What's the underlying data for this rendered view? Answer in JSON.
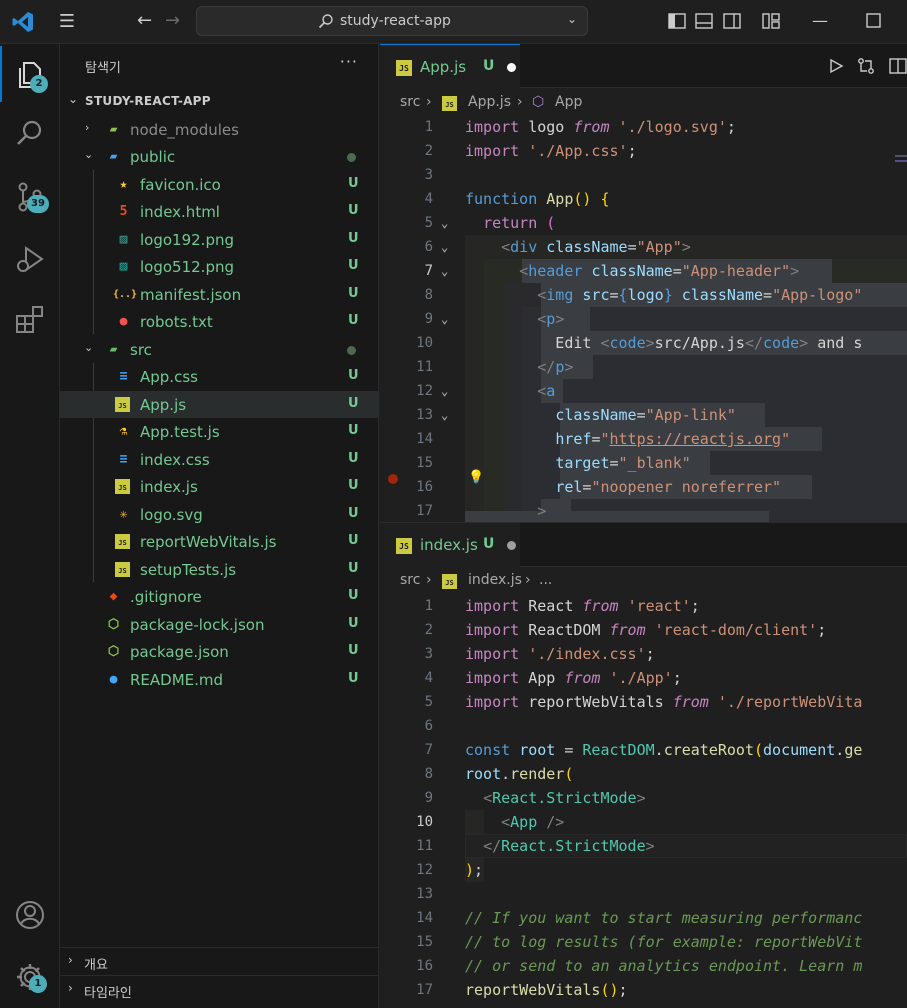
{
  "titlebar": {
    "search_text": "study-react-app",
    "icons": [
      "vscode-logo-icon",
      "menu-icon",
      "back-arrow-icon",
      "forward-arrow-icon",
      "search-icon",
      "chevron-down-icon",
      "toggle-primary-sidebar-icon",
      "toggle-panel-icon",
      "toggle-secondary-sidebar-icon",
      "customize-layout-icon",
      "minimize-icon",
      "maximize-icon"
    ]
  },
  "activitybar": {
    "explorer_badge": "2",
    "scm_badge": "39",
    "settings_badge": "1"
  },
  "sidebar": {
    "title": "탐색기",
    "more": "···",
    "root": "STUDY-REACT-APP",
    "items": [
      {
        "name": "node_modules",
        "status": ""
      },
      {
        "name": "public",
        "status": ""
      },
      {
        "name": "favicon.ico",
        "status": "U"
      },
      {
        "name": "index.html",
        "status": "U"
      },
      {
        "name": "logo192.png",
        "status": "U"
      },
      {
        "name": "logo512.png",
        "status": "U"
      },
      {
        "name": "manifest.json",
        "status": "U"
      },
      {
        "name": "robots.txt",
        "status": "U"
      },
      {
        "name": "src",
        "status": ""
      },
      {
        "name": "App.css",
        "status": "U"
      },
      {
        "name": "App.js",
        "status": "U"
      },
      {
        "name": "App.test.js",
        "status": "U"
      },
      {
        "name": "index.css",
        "status": "U"
      },
      {
        "name": "index.js",
        "status": "U"
      },
      {
        "name": "logo.svg",
        "status": "U"
      },
      {
        "name": "reportWebVitals.js",
        "status": "U"
      },
      {
        "name": "setupTests.js",
        "status": "U"
      },
      {
        "name": ".gitignore",
        "status": "U"
      },
      {
        "name": "package-lock.json",
        "status": "U"
      },
      {
        "name": "package.json",
        "status": "U"
      },
      {
        "name": "README.md",
        "status": "U"
      }
    ],
    "section_outline": "개요",
    "section_timeline": "타임라인"
  },
  "editor1": {
    "tab_name": "App.js",
    "tab_status": "U",
    "breadcrumb": [
      "src",
      "App.js",
      "App"
    ],
    "line_numbers": [
      "1",
      "2",
      "3",
      "4",
      "5",
      "6",
      "7",
      "8",
      "9",
      "10",
      "11",
      "12",
      "13",
      "14",
      "15",
      "16",
      "17"
    ]
  },
  "editor2": {
    "tab_name": "index.js",
    "tab_status": "U",
    "breadcrumb": [
      "src",
      "index.js",
      "..."
    ],
    "line_numbers": [
      "1",
      "2",
      "3",
      "4",
      "5",
      "6",
      "7",
      "8",
      "9",
      "10",
      "11",
      "12",
      "13",
      "14",
      "15",
      "16",
      "17"
    ]
  },
  "colors": {
    "accent": "#0078d4",
    "git_untracked": "#73c991",
    "badge": "#4dadb8"
  }
}
